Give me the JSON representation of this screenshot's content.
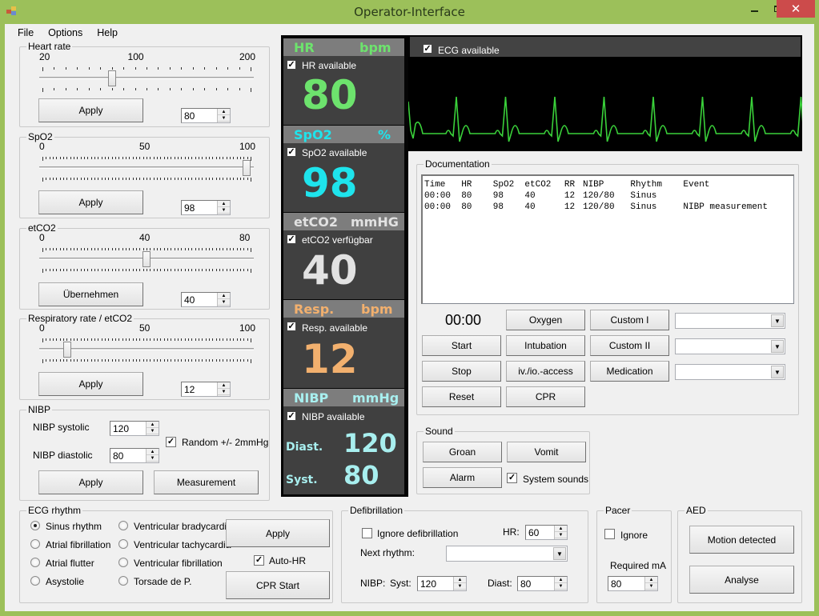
{
  "window": {
    "title": "Operator-Interface",
    "minimize": "–",
    "maximize": "☐",
    "close": "✕"
  },
  "menu": [
    "File",
    "Options",
    "Help"
  ],
  "heart_rate": {
    "label": "Heart rate",
    "min_label": "20",
    "mid_label": "100",
    "max_label": "200",
    "min": 20,
    "max": 200,
    "value": 80,
    "apply": "Apply",
    "spin_value": "80"
  },
  "spo2": {
    "label": "SpO2",
    "min_label": "0",
    "mid_label": "50",
    "max_label": "100",
    "min": 0,
    "max": 100,
    "value": 98,
    "apply": "Apply",
    "spin_value": "98"
  },
  "etco2": {
    "label": "etCO2",
    "min_label": "0",
    "mid_label": "40",
    "max_label": "80",
    "min": 0,
    "max": 80,
    "value": 40,
    "apply": "Übernehmen",
    "spin_value": "40"
  },
  "resp": {
    "label": "Respiratory rate / etCO2",
    "min_label": "0",
    "mid_label": "50",
    "max_label": "100",
    "min": 0,
    "max": 100,
    "value": 12,
    "apply": "Apply",
    "spin_value": "12"
  },
  "nibp": {
    "label": "NIBP",
    "systolic_label": "NIBP systolic",
    "systolic": "120",
    "diastolic_label": "NIBP diastolic",
    "diastolic": "80",
    "random_label": "Random +/- 2mmHg",
    "random_checked": true,
    "apply": "Apply",
    "measurement": "Measurement"
  },
  "vitals": {
    "hr": {
      "name": "HR",
      "unit": "bpm",
      "avail": "HR available",
      "value": "80",
      "color": "#6de36d"
    },
    "spo2": {
      "name": "SpO2",
      "unit": "%",
      "avail": "SpO2 available",
      "value": "98",
      "color": "#1ee4ec"
    },
    "etco2": {
      "name": "etCO2",
      "unit": "mmHG",
      "avail": "etCO2 verfügbar",
      "value": "40",
      "color": "#e2e2e2"
    },
    "resp": {
      "name": "Resp.",
      "unit": "bpm",
      "avail": "Resp. available",
      "value": "12",
      "color": "#f2b06e"
    },
    "nibp": {
      "name": "NIBP",
      "unit": "mmHg",
      "avail": "NIBP available",
      "diast_label": "Diast.",
      "diast": "120",
      "syst_label": "Syst.",
      "syst": "80",
      "color": "#a8efef"
    }
  },
  "ecg": {
    "avail": "ECG available",
    "color": "#3ad13a"
  },
  "documentation": {
    "label": "Documentation",
    "columns": [
      "Time",
      "HR",
      "SpO2",
      "etCO2",
      "RR",
      "NIBP",
      "Rhythm",
      "Event"
    ],
    "rows": [
      [
        "00:00",
        "80",
        "98",
        "40",
        "12",
        "120/80",
        "Sinus",
        ""
      ],
      [
        "00:00",
        "80",
        "98",
        "40",
        "12",
        "120/80",
        "Sinus",
        "NIBP measurement"
      ]
    ],
    "timer": "00:00",
    "buttons": {
      "start": "Start",
      "stop": "Stop",
      "reset": "Reset",
      "oxygen": "Oxygen",
      "intubation": "Intubation",
      "access": "iv./io.-access",
      "cpr": "CPR",
      "custom1": "Custom I",
      "custom2": "Custom II",
      "medication": "Medication"
    }
  },
  "sound": {
    "label": "Sound",
    "groan": "Groan",
    "vomit": "Vomit",
    "alarm": "Alarm",
    "system": "System sounds",
    "system_checked": true
  },
  "ecg_rhythm": {
    "label": "ECG rhythm",
    "options": [
      "Sinus rhythm",
      "Atrial fibrillation",
      "Atrial flutter",
      "Asystolie",
      "Ventricular bradycardia",
      "Ventricular tachycardia",
      "Ventricular fibrillation",
      "Torsade de P."
    ],
    "selected": "Sinus rhythm",
    "apply": "Apply",
    "auto_hr": "Auto-HR",
    "auto_hr_checked": true,
    "cpr_start": "CPR Start"
  },
  "defib": {
    "label": "Defibrillation",
    "ignore": "Ignore defibrillation",
    "hr_label": "HR:",
    "hr": "60",
    "next_rhythm": "Next rhythm:",
    "nibp_label": "NIBP:",
    "syst_label": "Syst:",
    "syst": "120",
    "diast_label": "Diast:",
    "diast": "80"
  },
  "pacer": {
    "label": "Pacer",
    "ignore": "Ignore",
    "required": "Required mA",
    "ma": "80"
  },
  "aed": {
    "label": "AED",
    "motion": "Motion detected",
    "analyse": "Analyse"
  }
}
